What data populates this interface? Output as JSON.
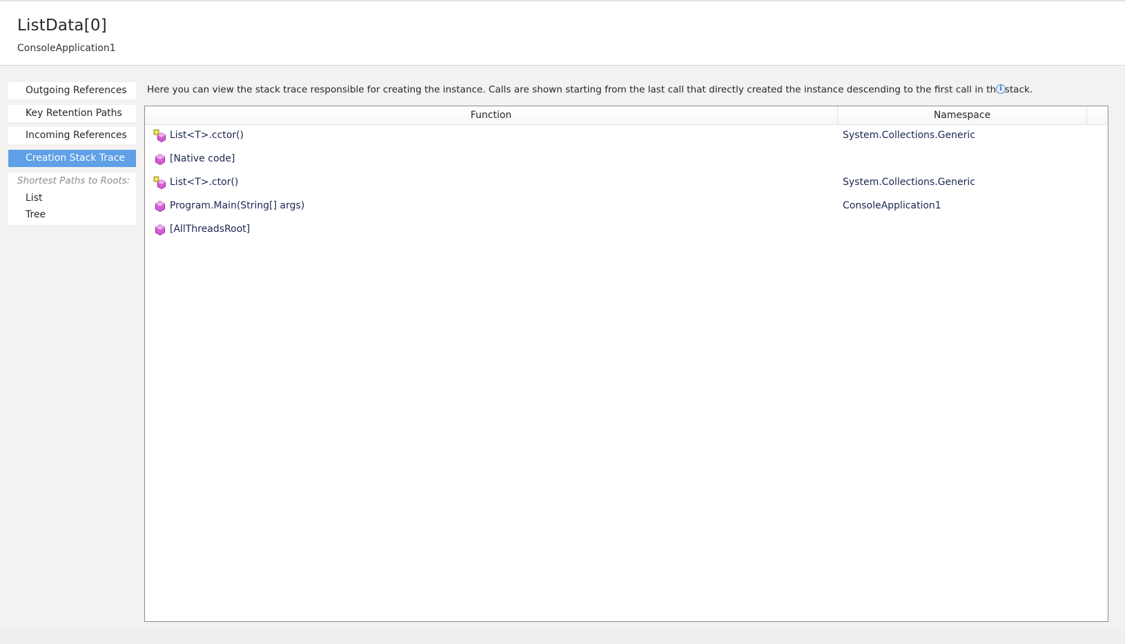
{
  "header": {
    "title": "ListData[0]",
    "subtitle": "ConsoleApplication1"
  },
  "sidebar": {
    "items": [
      {
        "label": "Outgoing References",
        "active": false
      },
      {
        "label": "Key Retention Paths",
        "active": false
      },
      {
        "label": "Incoming References",
        "active": false
      },
      {
        "label": "Creation Stack Trace",
        "active": true
      }
    ],
    "roots": {
      "label": "Shortest Paths to Roots:",
      "links": [
        {
          "label": "List"
        },
        {
          "label": "Tree"
        }
      ]
    }
  },
  "main": {
    "description": "Here you can view the stack trace responsible for creating the instance. Calls are shown starting from the last call that directly created the instance descending to the first call in the stack.",
    "info_icon": "info-icon",
    "grid": {
      "columns": [
        "Function",
        "Namespace"
      ],
      "rows": [
        {
          "function": "List<T>.cctor()",
          "namespace": "System.Collections.Generic",
          "icon": "static-method-icon"
        },
        {
          "function": "[Native code]",
          "namespace": "",
          "icon": "method-icon"
        },
        {
          "function": "List<T>.ctor()",
          "namespace": "System.Collections.Generic",
          "icon": "static-method-icon"
        },
        {
          "function": "Program.Main(String[] args)",
          "namespace": "ConsoleApplication1",
          "icon": "method-icon"
        },
        {
          "function": "[AllThreadsRoot]",
          "namespace": "",
          "icon": "method-icon"
        }
      ]
    }
  },
  "colors": {
    "accent": "#5fa0e6",
    "method_icon": "#d45fd4",
    "static_badge": "#e8d24a"
  }
}
